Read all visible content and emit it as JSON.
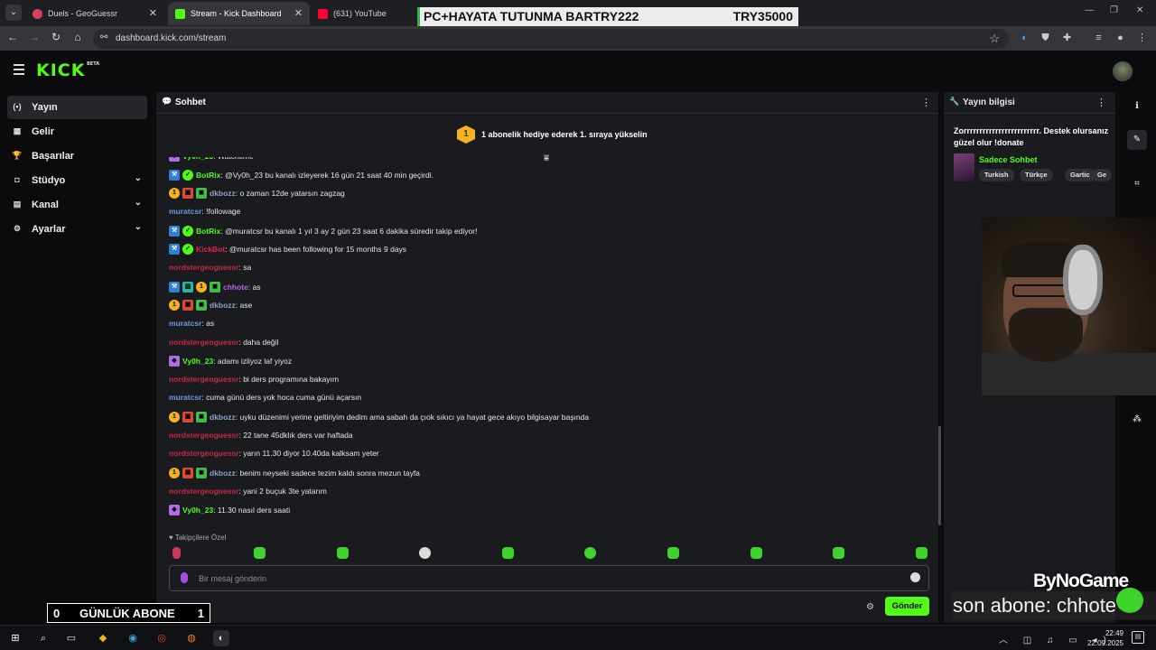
{
  "browser": {
    "tabs": [
      {
        "title": "Duels - GeoGuessr",
        "close": "✕"
      },
      {
        "title": "Stream - Kick Dashboard",
        "close": "✕"
      },
      {
        "title": "(631) YouTube",
        "close": ""
      }
    ],
    "url": "dashboard.kick.com/stream",
    "window_controls": [
      "—",
      "❐",
      "✕"
    ]
  },
  "overlay_bar": {
    "left_text": "PC+HAYATA TUTUNMA BARTRY222",
    "right_text": "TRY35000"
  },
  "kick": {
    "logo": "KICK",
    "logo_badge": "BETA",
    "sidebar": [
      {
        "label": "Yayın",
        "icon": "(•)",
        "active": true,
        "chevron": false
      },
      {
        "label": "Gelir",
        "icon": "▦",
        "active": false,
        "chevron": false
      },
      {
        "label": "Başarılar",
        "icon": "🏆",
        "active": false,
        "chevron": false
      },
      {
        "label": "Stüdyo",
        "icon": "◘",
        "active": false,
        "chevron": true
      },
      {
        "label": "Kanal",
        "icon": "▤",
        "active": false,
        "chevron": true
      },
      {
        "label": "Ayarlar",
        "icon": "⚙",
        "active": false,
        "chevron": true
      }
    ]
  },
  "chat": {
    "title": "Sohbet",
    "promo": {
      "badge": "1",
      "text": "1 abonelik hediye ederek 1. sıraya yükselin"
    },
    "messages": [
      {
        "user": "Vy0h_23",
        "color": "#53fc18",
        "badges": [
          "vip"
        ],
        "text": ": Watchtime"
      },
      {
        "user": "BotRix",
        "color": "#53fc18",
        "badges": [
          "mod",
          "ver"
        ],
        "text": ": @Vy0h_23 bu kanalı izleyerek 16 gün 21 saat 40 min geçirdi."
      },
      {
        "user": "dkbozz",
        "color": "#8ea1c9",
        "badges": [
          "sub",
          "gift",
          "green"
        ],
        "text": ": o zaman 12de yatarsın zagzag"
      },
      {
        "user": "muratcsr",
        "color": "#6f9be0",
        "badges": [],
        "text": ": !followage"
      },
      {
        "user": "BotRix",
        "color": "#53fc18",
        "badges": [
          "mod",
          "ver"
        ],
        "text": ": @muratcsr bu kanalı 1 yıl 3 ay 2 gün 23 saat 6 dakika süredir takip ediyor!"
      },
      {
        "user": "KickBot",
        "color": "#e0224b",
        "badges": [
          "mod",
          "ver"
        ],
        "text": ": @muratcsr has been following for 15 months 9 days"
      },
      {
        "user": "nordstergeoguessr",
        "color": "#c8284a",
        "badges": [],
        "text": ": sa"
      },
      {
        "user": "chhote",
        "color": "#b36ae6",
        "badges": [
          "mod",
          "og",
          "sub",
          "green"
        ],
        "text": ": as"
      },
      {
        "user": "dkbozz",
        "color": "#8ea1c9",
        "badges": [
          "sub",
          "gift",
          "green"
        ],
        "text": ": ase"
      },
      {
        "user": "muratcsr",
        "color": "#6f9be0",
        "badges": [],
        "text": ": as"
      },
      {
        "user": "nordstergeoguessr",
        "color": "#c8284a",
        "badges": [],
        "text": ": daha değil"
      },
      {
        "user": "Vy0h_23",
        "color": "#53fc18",
        "badges": [
          "vip"
        ],
        "text": ": adamı izliyoz laf yiyoz"
      },
      {
        "user": "nordstergeoguessr",
        "color": "#c8284a",
        "badges": [],
        "text": ": bi ders programına bakayım"
      },
      {
        "user": "muratcsr",
        "color": "#6f9be0",
        "badges": [],
        "text": ": cuma günü ders yok hoca cuma günü açarsın"
      },
      {
        "user": "dkbozz",
        "color": "#8ea1c9",
        "badges": [
          "sub",
          "gift",
          "green"
        ],
        "text": ": uyku düzenimi yerine geltiriyim dedim ama sabah da çıok sıkıcı ya hayat gece akıyo bilgisayar başında"
      },
      {
        "user": "nordstergeoguessr",
        "color": "#c8284a",
        "badges": [],
        "text": ": 22 tane 45dklık ders var haftada"
      },
      {
        "user": "nordstergeoguessr",
        "color": "#c8284a",
        "badges": [],
        "text": ": yarın 11.30 diyor 10.40da kalksam yeter"
      },
      {
        "user": "dkbozz",
        "color": "#8ea1c9",
        "badges": [
          "sub",
          "gift",
          "green"
        ],
        "text": ": benim neyseki sadece tezim kaldı sonra mezun tayfa"
      },
      {
        "user": "nordstergeoguessr",
        "color": "#c8284a",
        "badges": [],
        "text": ": yani 2 buçuk 3te yatarım"
      },
      {
        "user": "Vy0h_23",
        "color": "#53fc18",
        "badges": [
          "vip"
        ],
        "text": ": 11.30 nasıl ders saati"
      }
    ],
    "followers_only": "Takipçilere Özel",
    "input_placeholder": "Bir mesaj gönderin",
    "send_label": "Gönder"
  },
  "info": {
    "title": "Yayın bilgisi",
    "stream_title": "Zorrrrrrrrrrrrrrrrrrrrrrrr. Destek olursanız güzel olur !donate",
    "category": "Sadece Sohbet",
    "tags": [
      "Turkish",
      "Türkçe",
      "Gartic",
      "Ge"
    ]
  },
  "overlays": {
    "sub_counter_left": "0",
    "sub_counter_label": "GÜNLÜK ABONE",
    "sub_counter_right": "1",
    "brand": "ByNoGame",
    "last_sub": "son abone: chhote"
  },
  "taskbar": {
    "time": "22:49",
    "date": "22.09.2025"
  },
  "colors": {
    "kick_green": "#53fc18",
    "panel": "#191b1f",
    "bg": "#0b0b0d"
  }
}
